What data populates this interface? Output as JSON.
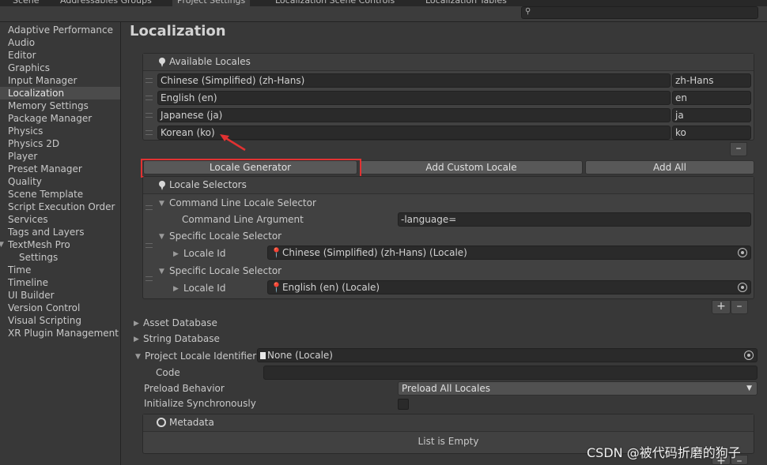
{
  "tabs": [
    "Scene",
    "Addressables Groups",
    "Project Settings",
    "Localization Scene Controls",
    "Localization Tables"
  ],
  "search": {
    "placeholder": ""
  },
  "sidebar": {
    "items": [
      "Adaptive Performance",
      "Audio",
      "Editor",
      "Graphics",
      "Input Manager",
      "Localization",
      "Memory Settings",
      "Package Manager",
      "Physics",
      "Physics 2D",
      "Player",
      "Preset Manager",
      "Quality",
      "Scene Template",
      "Script Execution Order",
      "Services",
      "Tags and Layers",
      "TextMesh Pro",
      "Settings",
      "Time",
      "Timeline",
      "UI Builder",
      "Version Control",
      "Visual Scripting",
      "XR Plugin Management"
    ],
    "selected": "Localization"
  },
  "page": {
    "title": "Localization"
  },
  "available_locales": {
    "header": "Available Locales",
    "rows": [
      {
        "name": "Chinese (Simplified) (zh-Hans)",
        "code": "zh-Hans"
      },
      {
        "name": "English (en)",
        "code": "en"
      },
      {
        "name": "Japanese (ja)",
        "code": "ja"
      },
      {
        "name": "Korean (ko)",
        "code": "ko"
      }
    ],
    "remove_label": "–"
  },
  "buttons": {
    "locale_generator": "Locale Generator",
    "add_custom_locale": "Add Custom Locale",
    "add_all": "Add All"
  },
  "locale_selectors": {
    "header": "Locale Selectors",
    "command_line": {
      "title": "Command Line Locale Selector",
      "argument_label": "Command Line Argument",
      "argument_value": "-language="
    },
    "specific": [
      {
        "title": "Specific Locale Selector",
        "locale_id_label": "Locale Id",
        "value": "Chinese (Simplified) (zh-Hans) (Locale)"
      },
      {
        "title": "Specific Locale Selector",
        "locale_id_label": "Locale Id",
        "value": "English (en) (Locale)"
      }
    ],
    "add_label": "+",
    "remove_label": "–"
  },
  "sections": {
    "asset_database": "Asset Database",
    "string_database": "String Database",
    "project_locale_identifier": "Project Locale Identifier",
    "project_locale_value": "None (Locale)",
    "code_label": "Code",
    "code_value": "",
    "preload_behavior_label": "Preload Behavior",
    "preload_behavior_value": "Preload All Locales",
    "initialize_sync_label": "Initialize Synchronously"
  },
  "metadata": {
    "header": "Metadata",
    "empty_text": "List is Empty"
  },
  "watermark": "CSDN @被代码折磨的狗子",
  "colors": {
    "highlight": "#e23232",
    "background": "#383838",
    "field": "#2a2a2a"
  }
}
